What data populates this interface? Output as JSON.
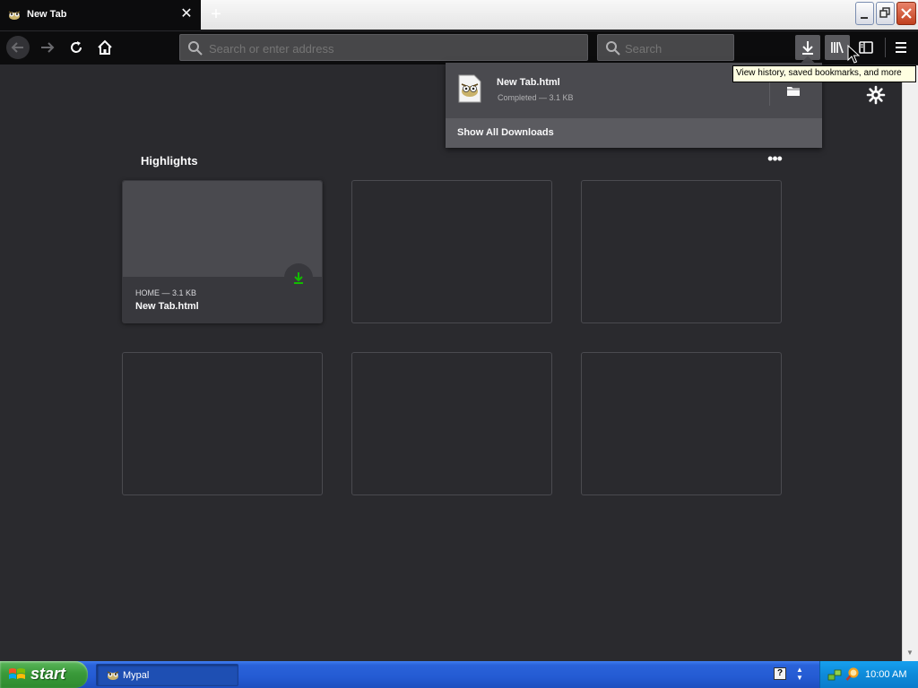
{
  "browser": {
    "tab": {
      "title": "New Tab",
      "close_symbol": "✕"
    },
    "newtab_symbol": "+",
    "urlbar": {
      "placeholder": "Search or enter address",
      "value": ""
    },
    "searchbar": {
      "placeholder": "Search",
      "value": ""
    },
    "tooltip": "View history, saved bookmarks, and more",
    "icons": {
      "back": "back-arrow-icon",
      "forward": "forward-arrow-icon",
      "reload": "reload-icon",
      "home": "home-icon",
      "downloads": "download-arrow-icon",
      "library": "library-icon",
      "sidebar": "sidebar-icon",
      "menu": "hamburger-menu-icon"
    }
  },
  "downloads_panel": {
    "item": {
      "name": "New Tab.html",
      "status": "Completed — 3.1 KB"
    },
    "show_all_label": "Show All Downloads"
  },
  "newtab": {
    "highlights_title": "Highlights",
    "highlights_menu_symbol": "•••",
    "cards": [
      {
        "context": "HOME — 3.1 KB",
        "title": "New Tab.html",
        "type": "download"
      }
    ]
  },
  "taskbar": {
    "start_label": "start",
    "task_label": "Mypal",
    "clock": "10:00 AM",
    "help_symbol": "?"
  },
  "colors": {
    "content_bg": "#2a2a2e",
    "toolbar_bg": "#0c0c0d",
    "panel_bg": "#4a4a4f",
    "download_green": "#12bc00",
    "taskbar_blue": "#245bd3",
    "start_green": "#3a9a3a"
  }
}
